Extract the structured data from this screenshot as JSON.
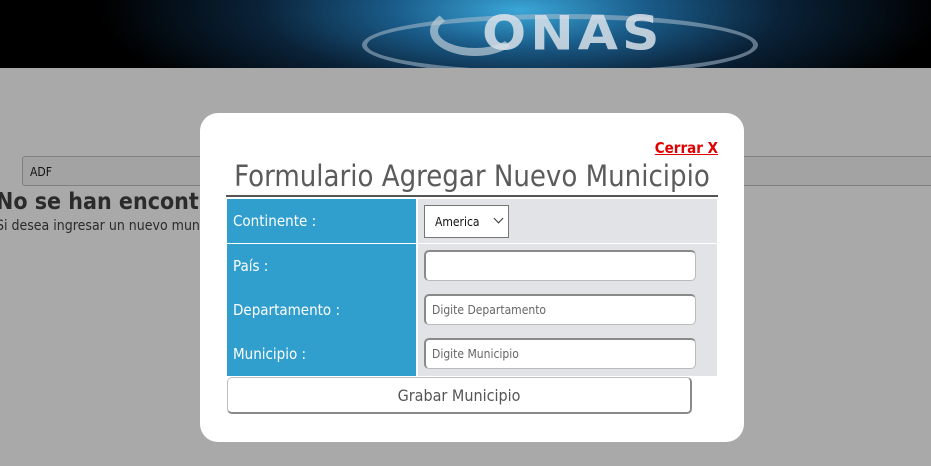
{
  "background": {
    "logo_text": "ONAS",
    "search_value": "ADF",
    "heading": "No se han encontrado",
    "subtext": "Si desea ingresar un nuevo munic"
  },
  "modal": {
    "close_label": "Cerrar X",
    "title": "Formulario Agregar Nuevo Municipio",
    "fields": {
      "continente_label": "Continente :",
      "continente_value": "America",
      "pais_label": "País :",
      "pais_value": "",
      "departamento_label": "Departamento :",
      "departamento_placeholder": "Digite Departamento",
      "municipio_label": "Municipio :",
      "municipio_placeholder": "Digite Municipio"
    },
    "submit_label": "Grabar Municipio"
  },
  "colors": {
    "label_bg": "#309fcd",
    "cell_bg": "#e1e3e7",
    "close_link": "#e00000",
    "overlay": "#a9a9a9"
  }
}
